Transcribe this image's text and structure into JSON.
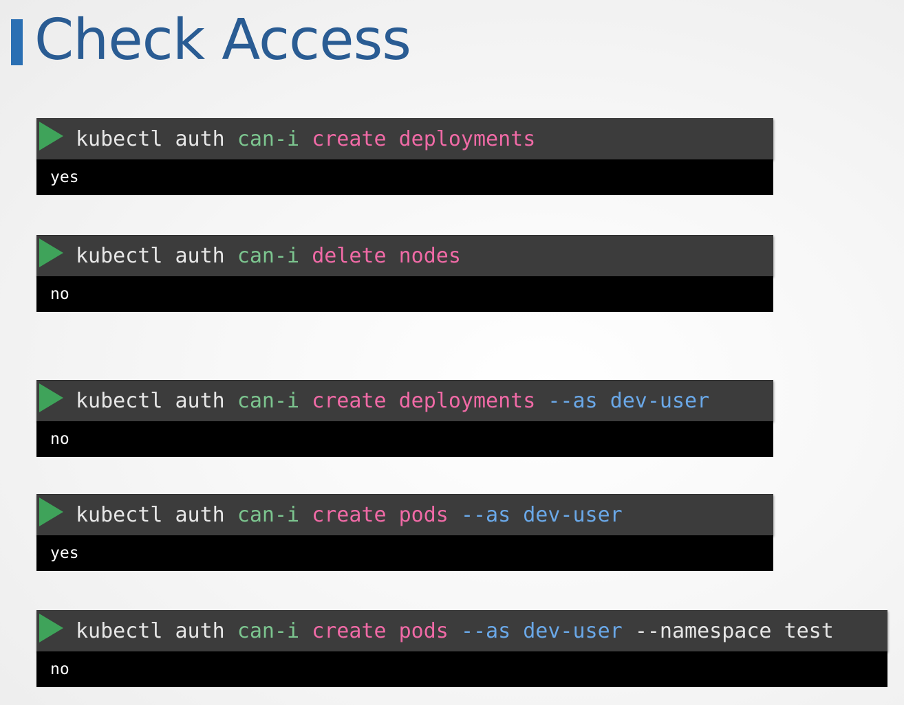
{
  "title": "Check Access",
  "colors": {
    "title": "#2a5c93",
    "accent_bar": "#2a6fb3",
    "command_bg": "#3c3c3c",
    "output_bg": "#000000",
    "play": "#3fa35a",
    "base": "#e6e6e6",
    "green": "#7cc58f",
    "pink": "#f06aa6",
    "blue": "#6aa8e8"
  },
  "commands": [
    {
      "tokens": [
        {
          "text": "kubectl",
          "color": "base"
        },
        {
          "text": "auth",
          "color": "base"
        },
        {
          "text": "can-i",
          "color": "green"
        },
        {
          "text": "create",
          "color": "pink"
        },
        {
          "text": "deployments",
          "color": "pink"
        }
      ],
      "output": "yes"
    },
    {
      "tokens": [
        {
          "text": "kubectl",
          "color": "base"
        },
        {
          "text": "auth",
          "color": "base"
        },
        {
          "text": "can-i",
          "color": "green"
        },
        {
          "text": "delete",
          "color": "pink"
        },
        {
          "text": "nodes",
          "color": "pink"
        }
      ],
      "output": "no"
    },
    {
      "tokens": [
        {
          "text": "kubectl",
          "color": "base"
        },
        {
          "text": "auth",
          "color": "base"
        },
        {
          "text": "can-i",
          "color": "green"
        },
        {
          "text": "create",
          "color": "pink"
        },
        {
          "text": "deployments",
          "color": "pink"
        },
        {
          "text": "--as",
          "color": "blue"
        },
        {
          "text": "dev-user",
          "color": "blue"
        }
      ],
      "output": "no"
    },
    {
      "tokens": [
        {
          "text": "kubectl",
          "color": "base"
        },
        {
          "text": "auth",
          "color": "base"
        },
        {
          "text": "can-i",
          "color": "green"
        },
        {
          "text": "create",
          "color": "pink"
        },
        {
          "text": "pods",
          "color": "pink"
        },
        {
          "text": "--as",
          "color": "blue"
        },
        {
          "text": "dev-user",
          "color": "blue"
        }
      ],
      "output": "yes"
    },
    {
      "tokens": [
        {
          "text": "kubectl",
          "color": "base"
        },
        {
          "text": "auth",
          "color": "base"
        },
        {
          "text": "can-i",
          "color": "green"
        },
        {
          "text": "create",
          "color": "pink"
        },
        {
          "text": "pods",
          "color": "pink"
        },
        {
          "text": "--as",
          "color": "blue"
        },
        {
          "text": "dev-user",
          "color": "blue"
        },
        {
          "text": "--namespace",
          "color": "base"
        },
        {
          "text": "test",
          "color": "base"
        }
      ],
      "output": "no"
    }
  ]
}
